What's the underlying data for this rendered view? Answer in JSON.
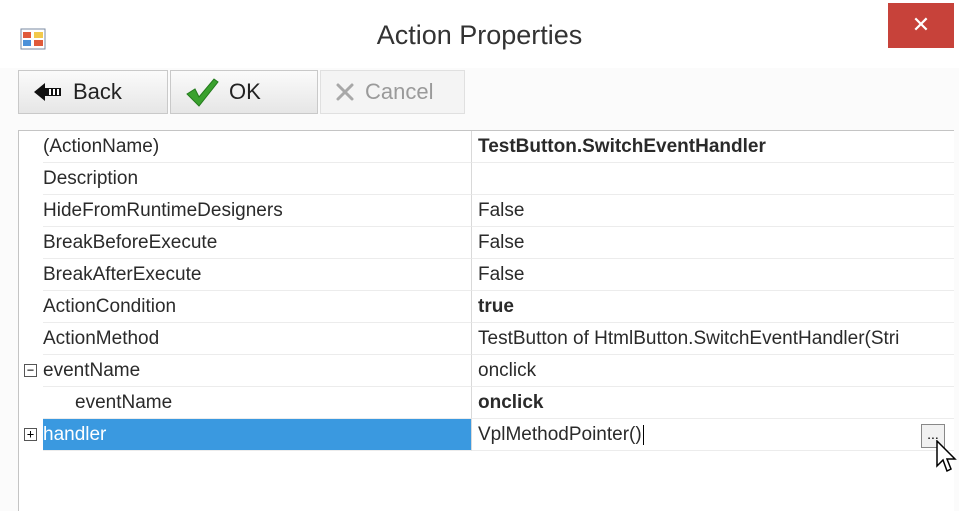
{
  "window": {
    "title": "Action Properties",
    "close_glyph": "✕",
    "app_icon": "properties-grid-icon"
  },
  "toolbar": {
    "back_label": "Back",
    "ok_label": "OK",
    "cancel_label": "Cancel",
    "cancel_enabled": false
  },
  "properties": [
    {
      "name": "(ActionName)",
      "value": "TestButton.SwitchEventHandler",
      "bold": true
    },
    {
      "name": "Description",
      "value": ""
    },
    {
      "name": "HideFromRuntimeDesigners",
      "value": "False"
    },
    {
      "name": "BreakBeforeExecute",
      "value": "False"
    },
    {
      "name": "BreakAfterExecute",
      "value": "False"
    },
    {
      "name": "ActionCondition",
      "value": "true",
      "bold": true
    },
    {
      "name": "ActionMethod",
      "value": "TestButton of HtmlButton.SwitchEventHandler(Stri"
    },
    {
      "name": "eventName",
      "value": "onclick",
      "expander": "−"
    },
    {
      "name": "eventName",
      "value": "onclick",
      "bold": true
    },
    {
      "name": "handler",
      "value": "VplMethodPointer()",
      "expander": "+",
      "selected": true,
      "editing": true
    }
  ],
  "ellipsis_label": "...",
  "colors": {
    "selection": "#3a99e0",
    "close_button": "#c7423a",
    "ok_check": "#3aa12e"
  }
}
